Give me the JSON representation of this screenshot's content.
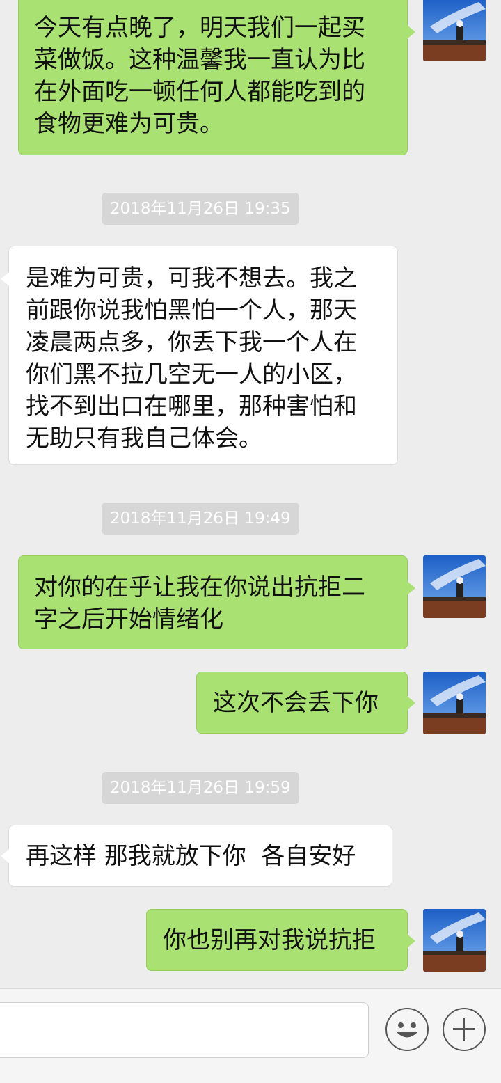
{
  "messages": [
    {
      "text": "今天有点晚了，明天我们一起买\n菜做饭。这种温馨我一直认为比\n在外面吃一顿任何人都能吃到的\n食物更难为可贵。"
    },
    {
      "text": "是难为可贵，可我不想去。我之\n前跟你说我怕黑怕一个人，那天\n凌晨两点多，你丢下我一个人在\n你们黑不拉几空无一人的小区，\n找不到出口在哪里，那种害怕和\n无助只有我自己体会。"
    },
    {
      "text": "对你的在乎让我在你说出抗拒二\n字之后开始情绪化"
    },
    {
      "text": "这次不会丢下你"
    },
    {
      "text": "再这样 那我就放下你  各自安好"
    },
    {
      "text": "你也别再对我说抗拒"
    }
  ],
  "timestamps": [
    "2018年11月26日 19:35",
    "2018年11月26日 19:49",
    "2018年11月26日 19:59"
  ],
  "input": {
    "value": ""
  },
  "icons": {
    "emoji": "emoji-icon",
    "plus": "plus-icon"
  },
  "colors": {
    "outgoing": "#a9e272",
    "incoming": "#ffffff",
    "background": "#ededed"
  }
}
